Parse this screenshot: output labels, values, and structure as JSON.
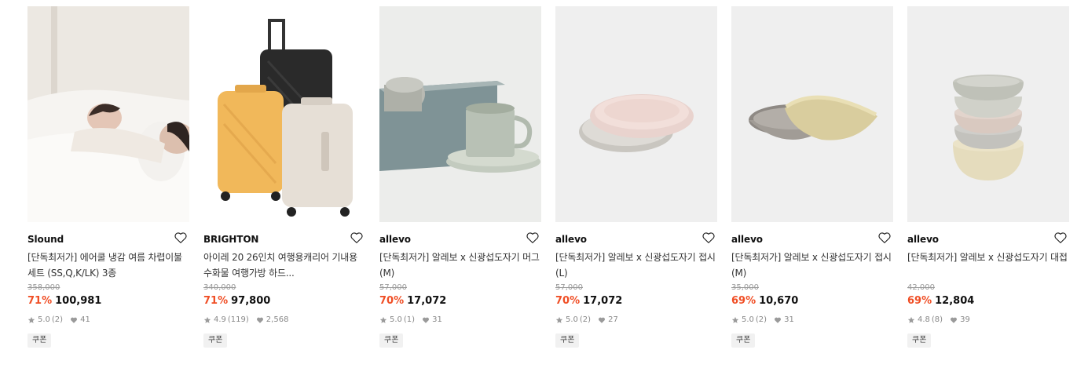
{
  "products": [
    {
      "brand": "Slound",
      "title": "[단독최저가] 에어쿨 냉감 여름 차렵이불 세트 (SS,Q,K/LK) 3종",
      "original_price": "358,000",
      "discount": "71%",
      "price": "100,981",
      "rating": "5.0",
      "reviews": "(2)",
      "likes": "41",
      "coupon": "쿠폰",
      "image_icon": "bedding-photo"
    },
    {
      "brand": "BRIGHTON",
      "title": "아이레 20 26인치 여행용캐리어 기내용 수화물 여행가방 하드...",
      "original_price": "340,000",
      "discount": "71%",
      "price": "97,800",
      "rating": "4.9",
      "reviews": "(119)",
      "likes": "2,568",
      "coupon": "쿠폰",
      "image_icon": "suitcase-photo"
    },
    {
      "brand": "allevo",
      "title": "[단독최저가] 알레보 x 신광섭도자기 머그(M)",
      "original_price": "57,000",
      "discount": "70%",
      "price": "17,072",
      "rating": "5.0",
      "reviews": "(1)",
      "likes": "31",
      "coupon": "쿠폰",
      "image_icon": "mug-photo"
    },
    {
      "brand": "allevo",
      "title": "[단독최저가] 알레보 x 신광섭도자기 접시(L)",
      "original_price": "57,000",
      "discount": "70%",
      "price": "17,072",
      "rating": "5.0",
      "reviews": "(2)",
      "likes": "27",
      "coupon": "쿠폰",
      "image_icon": "plate-photo"
    },
    {
      "brand": "allevo",
      "title": "[단독최저가] 알레보 x 신광섭도자기 접시(M)",
      "original_price": "35,000",
      "discount": "69%",
      "price": "10,670",
      "rating": "5.0",
      "reviews": "(2)",
      "likes": "31",
      "coupon": "쿠폰",
      "image_icon": "dish-photo"
    },
    {
      "brand": "allevo",
      "title": "[단독최저가] 알레보 x 신광섭도자기 대접",
      "original_price": "42,000",
      "discount": "69%",
      "price": "12,804",
      "rating": "4.8",
      "reviews": "(8)",
      "likes": "39",
      "coupon": "쿠폰",
      "image_icon": "bowl-stack-photo"
    }
  ],
  "colors": {
    "discount": "#f04f26",
    "text": "#111111",
    "muted": "#888888"
  }
}
